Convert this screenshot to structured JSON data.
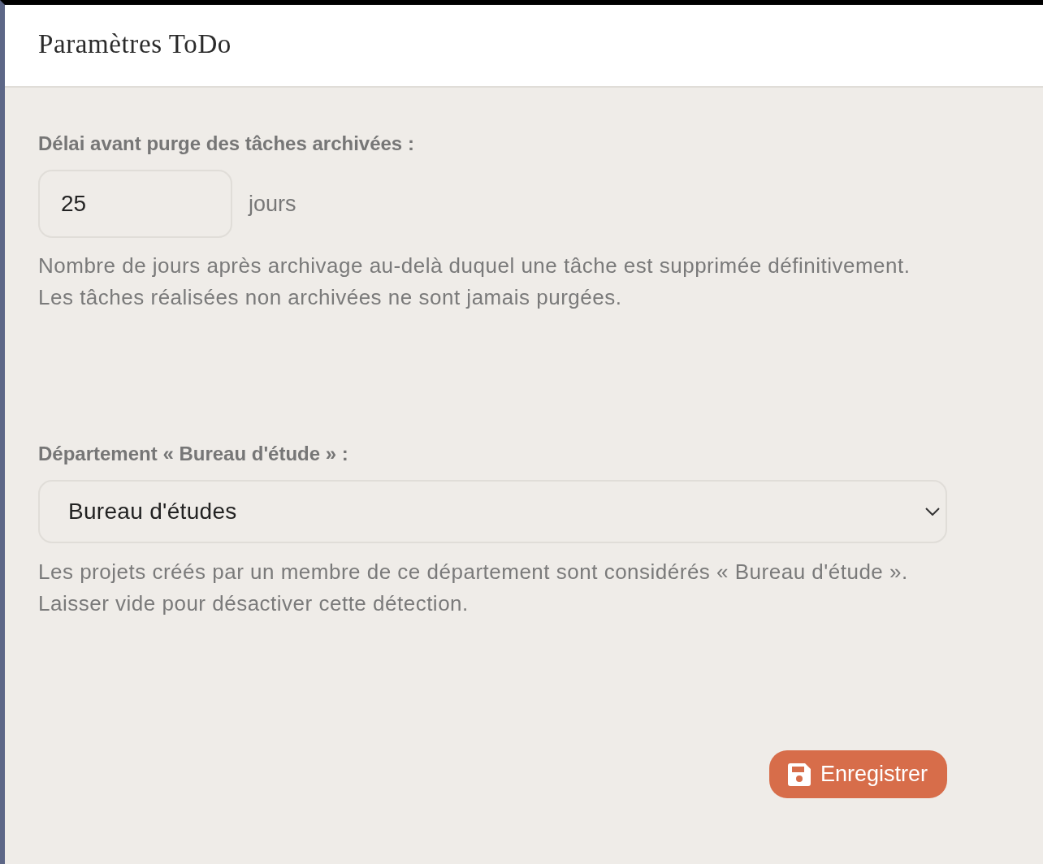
{
  "header": {
    "title": "Paramètres ToDo"
  },
  "fields": [
    {
      "kind": "number",
      "label": "Délai avant purge des tâches archivées :",
      "value": "25",
      "unit": "jours",
      "help": [
        "Nombre de jours après archivage au-delà duquel une tâche est supprimée définitivement.",
        "Les tâches réalisées non archivées ne sont jamais purgées."
      ]
    },
    {
      "kind": "select",
      "label": "Département « Bureau d'étude » :",
      "value": "Bureau d'études",
      "help": [
        "Les projets créés par un membre de ce département sont considérés « Bureau d'étude ».",
        "Laisser vide pour désactiver cette détection."
      ]
    }
  ],
  "save_button": {
    "label": "Enregistrer"
  }
}
